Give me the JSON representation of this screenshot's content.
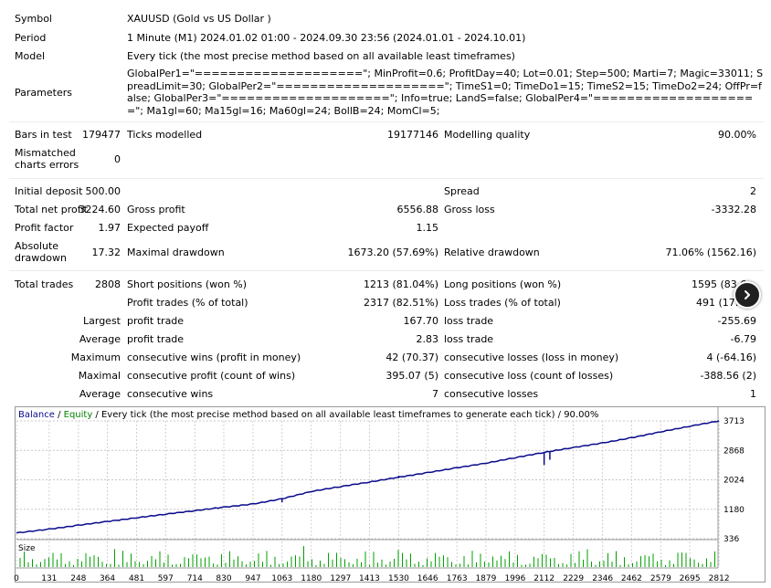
{
  "report": {
    "symbol_label": "Symbol",
    "symbol_value": "XAUUSD (Gold vs US Dollar )",
    "period_label": "Period",
    "period_value": "1 Minute (M1) 2024.01.02 01:00 - 2024.09.30 23:56 (2024.01.01 - 2024.10.01)",
    "model_label": "Model",
    "model_value": "Every tick (the most precise method based on all available least timeframes)",
    "parameters_label": "Parameters",
    "parameters_value": "GlobalPer1=\"====================\"; MinProfit=0.6; ProfitDay=40; Lot=0.01; Step=500; Marti=7; Magic=33011; SpreadLimit=30; GlobalPer2=\"====================\"; TimeS1=0; TimeDo1=15; TimeS2=15; TimeDo2=24; OffPr=false; GlobalPer3=\"====================\"; Info=true; LandS=false; GlobalPer4=\"====================\"; Ma1gl=60; Ma15gl=16; Ma60gl=24; BollB=24; MomCl=5;",
    "bars_label": "Bars in test",
    "bars_value": "179477",
    "ticks_label": "Ticks modelled",
    "ticks_value": "19177146",
    "quality_label": "Modelling quality",
    "quality_value": "90.00%",
    "mismatch_label_1": "Mismatched",
    "mismatch_label_2": "charts errors",
    "mismatch_value": "0",
    "deposit_label": "Initial deposit",
    "deposit_value": "500.00",
    "spread_label": "Spread",
    "spread_value": "2",
    "netprofit_label": "Total net profit",
    "netprofit_value": "3224.60",
    "grossprofit_label": "Gross profit",
    "grossprofit_value": "6556.88",
    "grossloss_label": "Gross loss",
    "grossloss_value": "-3332.28",
    "pf_label": "Profit factor",
    "pf_value": "1.97",
    "payoff_label": "Expected payoff",
    "payoff_value": "1.15",
    "absdd_label_1": "Absolute",
    "absdd_label_2": "drawdown",
    "absdd_value": "17.32",
    "maxdd_label": "Maximal drawdown",
    "maxdd_value": "1673.20 (57.69%)",
    "reldd_label": "Relative drawdown",
    "reldd_value": "71.06% (1562.16)",
    "trades_label": "Total trades",
    "trades_value": "2808",
    "short_label": "Short positions (won %)",
    "short_value": "1213 (81.04%)",
    "long_label": "Long positions (won %)",
    "long_value": "1595 (83.6",
    "ptrades_label": "Profit trades (% of total)",
    "ptrades_value": "2317 (82.51%)",
    "ltrades_label": "Loss trades (% of total)",
    "ltrades_value": "491 (17.4",
    "largest_label": "Largest",
    "largest_profit_label": "profit trade",
    "largest_profit_value": "167.70",
    "largest_loss_label": "loss trade",
    "largest_loss_value": "-255.69",
    "average_label": "Average",
    "average_profit_label": "profit trade",
    "average_profit_value": "2.83",
    "average_loss_label": "loss trade",
    "average_loss_value": "-6.79",
    "maximum_label": "Maximum",
    "max_wins_label": "consecutive wins (profit in money)",
    "max_wins_value": "42 (70.37)",
    "max_losses_label": "consecutive losses (loss in money)",
    "max_losses_value": "4 (-64.16)",
    "maximal_label": "Maximal",
    "maximal_profit_label": "consecutive profit (count of wins)",
    "maximal_profit_value": "395.07 (5)",
    "maximal_loss_label": "consecutive loss (count of losses)",
    "maximal_loss_value": "-388.56 (2)",
    "avg2_label": "Average",
    "avg_wins_label": "consecutive wins",
    "avg_wins_value": "7",
    "avg_losses_label": "consecutive losses",
    "avg_losses_value": "1"
  },
  "chart_legend": {
    "balance": "Balance",
    "sep1": " / ",
    "equity": "Equity",
    "rest": " / Every tick (the most precise method based on all available least timeframes to generate each tick) / 90.00%",
    "size": "Size"
  },
  "colors": {
    "balance": "#0a0a8c",
    "equity": "#008000",
    "size_bars": "#00a000",
    "scroll_button": "#202020"
  },
  "icons": {
    "scroll": "chevron-right-icon"
  },
  "chart_data": {
    "type": "line",
    "title": "",
    "series": [
      {
        "name": "Balance",
        "x": [
          0,
          131,
          248,
          364,
          481,
          597,
          714,
          830,
          947,
          1063,
          1180,
          1297,
          1413,
          1530,
          1646,
          1763,
          1879,
          1996,
          2112,
          2229,
          2346,
          2462,
          2579,
          2695,
          2812
        ],
        "values": [
          500,
          610,
          720,
          830,
          935,
          1040,
          1140,
          1240,
          1330,
          1480,
          1690,
          1830,
          1960,
          2100,
          2230,
          2370,
          2500,
          2660,
          2810,
          2950,
          3080,
          3230,
          3400,
          3560,
          3713
        ]
      }
    ],
    "ylim": [
      336,
      3713
    ],
    "y_ticks": [
      "3713",
      "2868",
      "2024",
      "1180",
      "336"
    ],
    "x_ticks": [
      "0",
      "131",
      "248",
      "364",
      "481",
      "597",
      "714",
      "830",
      "947",
      "1063",
      "1180",
      "1297",
      "1413",
      "1530",
      "1646",
      "1763",
      "1879",
      "1996",
      "2112",
      "2229",
      "2346",
      "2462",
      "2579",
      "2695",
      "2812"
    ],
    "xlim": [
      0,
      2808
    ],
    "grid": true
  }
}
